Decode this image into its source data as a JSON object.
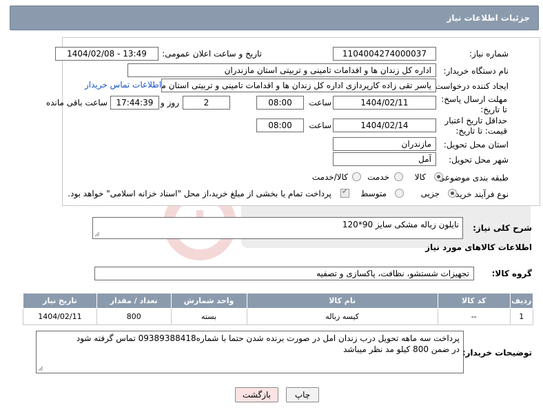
{
  "header": {
    "title": "جزئیات اطلاعات نیاز"
  },
  "form": {
    "need_number_label": "شماره نیاز:",
    "need_number": "1104004274000037",
    "announce_label": "تاریخ و ساعت اعلان عمومی:",
    "announce_value": "1404/02/08 - 13:49",
    "buyer_org_label": "نام دستگاه خریدار:",
    "buyer_org": "اداره کل زندان ها و اقدامات تامینی و تربیتی استان مازندران",
    "creator_label": "ایجاد کننده درخواست:",
    "creator": "یاسر تقی زاده کارپردازی اداره کل زندان ها و اقدامات تامینی و تربیتی استان مازندران",
    "contact_link": "اطلاعات تماس خریدار",
    "reply_deadline_label": "مهلت ارسال پاسخ: تا تاریخ:",
    "reply_date": "1404/02/11",
    "time_label": "ساعت",
    "reply_time": "08:00",
    "days_value": "2",
    "days_label": "روز و",
    "remaining_time": "17:44:39",
    "remaining_label": "ساعت باقی مانده",
    "price_validity_label": "حداقل تاریخ اعتبار قیمت: تا تاریخ:",
    "price_date": "1404/02/14",
    "price_time": "08:00",
    "province_label": "استان محل تحویل:",
    "province": "مازندران",
    "city_label": "شهر محل تحویل:",
    "city": "آمل",
    "category_label": "طبقه بندی موضوعی:",
    "category_options": [
      "کالا",
      "خدمت",
      "کالا/خدمت"
    ],
    "purchase_type_label": "نوع فرآیند خرید :",
    "purchase_options": [
      "جزیی",
      "متوسط"
    ],
    "payment_note": "پرداخت تمام یا بخشی از مبلغ خرید،از محل \"اسناد خزانه اسلامی\" خواهد بود."
  },
  "description": {
    "label": "شرح کلی نیاز:",
    "value": "نایلون زباله مشکی سایز 90*120"
  },
  "goods_section": {
    "title": "اطلاعات کالاهای مورد نیاز",
    "group_label": "گروه کالا:",
    "group_value": "تجهیزات شستشو، نظافت، پاکسازی و تصفیه"
  },
  "table": {
    "headers": [
      "ردیف",
      "کد کالا",
      "نام کالا",
      "واحد شمارش",
      "تعداد / مقدار",
      "تاریخ نیاز"
    ],
    "rows": [
      [
        "1",
        "--",
        "کیسه زباله",
        "بسته",
        "800",
        "1404/02/11"
      ]
    ]
  },
  "buyer_notes": {
    "label": "توضیحات خریدار:",
    "line1": "پرداخت سه ماهه تحویل درب زندان امل در صورت برنده شدن حتما با شماره09389388418 تماس گرفته شود",
    "line2": "در ضمن 800 کیلو مد نظر میباشد"
  },
  "buttons": {
    "print": "چاپ",
    "back": "بازگشت"
  },
  "colors": {
    "header_bg": "#8b9bad",
    "link": "#1a55c5",
    "back_bg": "#fbe3e3"
  }
}
